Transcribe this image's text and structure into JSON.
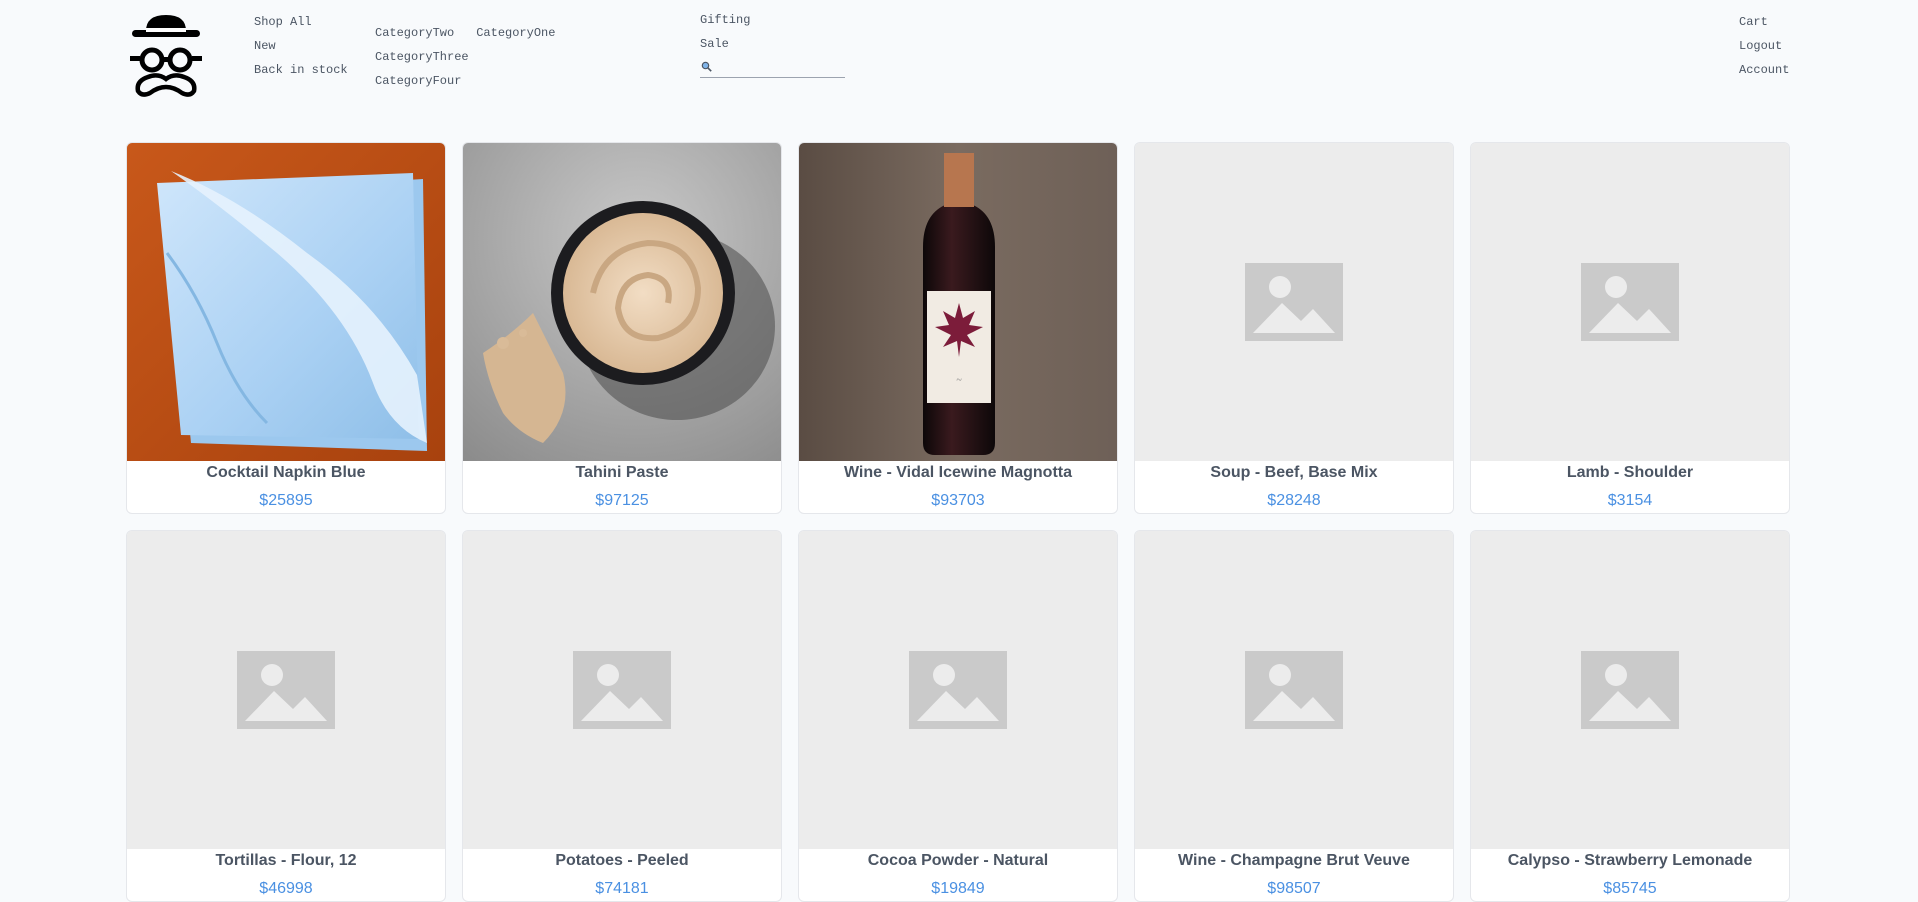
{
  "nav": {
    "primary": [
      {
        "label": "Shop All"
      },
      {
        "label": "New"
      },
      {
        "label": "Back in stock"
      }
    ],
    "categories": [
      {
        "label": "CategoryTwo"
      },
      {
        "label": "CategoryOne"
      },
      {
        "label": "CategoryThree"
      },
      {
        "label": "CategoryFour"
      }
    ],
    "secondary": [
      {
        "label": "Gifting"
      },
      {
        "label": "Sale"
      }
    ],
    "account": [
      {
        "label": "Cart"
      },
      {
        "label": "Logout"
      },
      {
        "label": "Account"
      }
    ]
  },
  "search": {
    "placeholder": "",
    "value": "",
    "icon": "magnifier-icon"
  },
  "products": [
    {
      "name": "Cocktail Napkin Blue",
      "price": "$25895",
      "image": "napkin"
    },
    {
      "name": "Tahini Paste",
      "price": "$97125",
      "image": "tahini"
    },
    {
      "name": "Wine - Vidal Icewine Magnotta",
      "price": "$93703",
      "image": "wine"
    },
    {
      "name": "Soup - Beef, Base Mix",
      "price": "$28248",
      "image": "placeholder"
    },
    {
      "name": "Lamb - Shoulder",
      "price": "$3154",
      "image": "placeholder"
    },
    {
      "name": "Tortillas - Flour, 12",
      "price": "$46998",
      "image": "placeholder"
    },
    {
      "name": "Potatoes - Peeled",
      "price": "$74181",
      "image": "placeholder"
    },
    {
      "name": "Cocoa Powder - Natural",
      "price": "$19849",
      "image": "placeholder"
    },
    {
      "name": "Wine - Champagne Brut Veuve",
      "price": "$98507",
      "image": "placeholder"
    },
    {
      "name": "Calypso - Strawberry Lemonade",
      "price": "$85745",
      "image": "placeholder"
    }
  ],
  "colors": {
    "price": "#4a90e2",
    "placeholder_bg": "#ececec",
    "placeholder_icon": "#cacaca"
  }
}
